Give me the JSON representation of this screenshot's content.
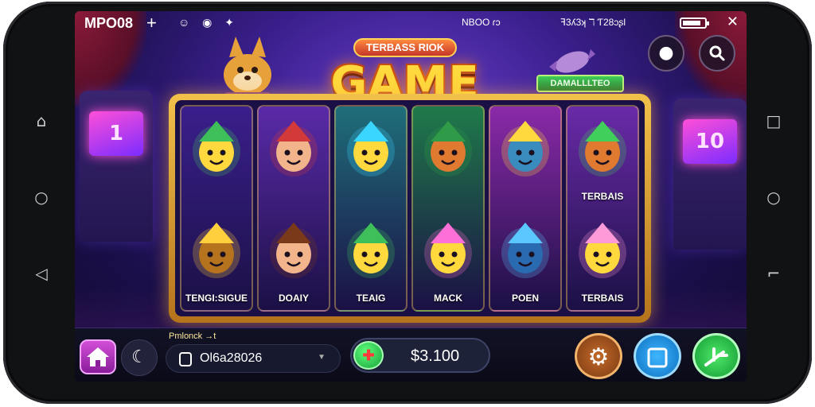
{
  "status_bar": {
    "left_text": "MPO08",
    "plus": "+",
    "center_text": "NBOO ɾɔ",
    "right_text": "ꟻ3ʎ3ʞ ℸ Ƭ28ɔʂl",
    "battery_level": 0.85
  },
  "header": {
    "subtitle": "TERBASS RIOK",
    "title": "GAME SLOT",
    "badge": "DAMALLLTEO",
    "profile_icon": "user-silhouette-icon",
    "search_icon": "search-icon"
  },
  "reels": [
    {
      "top": {
        "icon": "candy-wrapper"
      },
      "bottom": {
        "icon": "gold-letter-i",
        "caption": "TENGI:SIGUE"
      },
      "color": "#3a1f8c"
    },
    {
      "top": {
        "icon": "hooded-girl"
      },
      "bottom": {
        "icon": "boy-face",
        "caption": "DOAIY"
      },
      "color": "#5a2aa8"
    },
    {
      "top": {
        "icon": "crystal-gem"
      },
      "bottom": {
        "icon": "green-seven",
        "caption": "TEAIG"
      },
      "color": "#1f6e7a"
    },
    {
      "top": {
        "icon": "fox-green-hat"
      },
      "bottom": {
        "icon": "pink-letter-j",
        "caption": "MACK"
      },
      "color": "#1f7a4a"
    },
    {
      "top": {
        "icon": "yellow-cat"
      },
      "bottom": {
        "icon": "blue-cat",
        "caption": "POEN"
      },
      "color": "#8a2aa8"
    },
    {
      "top": {
        "icon": "fox-green-crest",
        "caption": "TERBAIS"
      },
      "bottom": {
        "icon": "candy-swirl",
        "caption": "TERBAIS"
      },
      "color": "#6a2aa8"
    }
  ],
  "bottom_bar": {
    "account_label": "Pmlonck →t",
    "account_number": "Ol6a28026",
    "balance": "$3.100",
    "home_icon": "home-icon",
    "moon_icon": "moon-icon",
    "settings_icon": "gear-icon",
    "stop_icon": "square-icon",
    "spin_icon": "spin-arrow-icon"
  },
  "colors": {
    "title_gold": "#ffd93d",
    "frame_gold": "#f1c14a",
    "spin_green": "#2ec24a",
    "stop_blue": "#1e8fe6",
    "settings_brown": "#b45a1e",
    "home_magenta": "#c13bce"
  }
}
